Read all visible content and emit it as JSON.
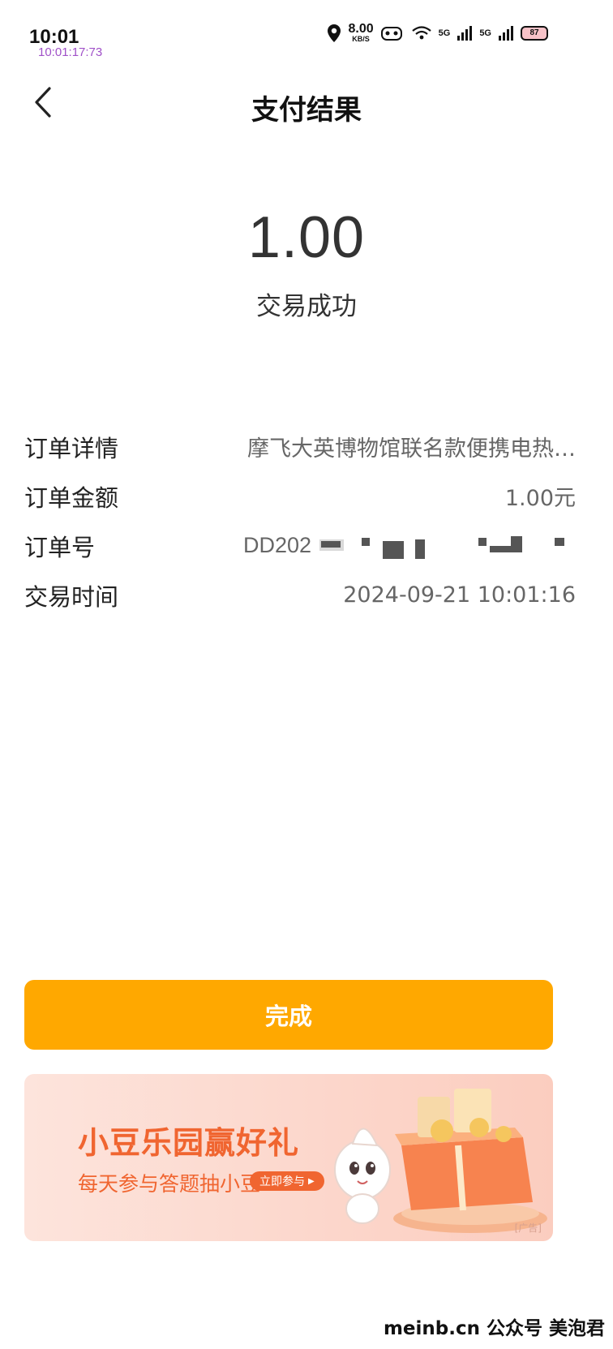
{
  "status_bar": {
    "time": "10:01",
    "sub_time": "10:01:17:73",
    "net_speed": "8.00",
    "net_unit": "KB/S",
    "signal_1": "5G",
    "signal_2": "5G",
    "battery": "87"
  },
  "header": {
    "title": "支付结果"
  },
  "payment": {
    "amount": "1.00",
    "status": "交易成功"
  },
  "details": {
    "rows": [
      {
        "label": "订单详情",
        "value": "摩飞大英博物馆联名款便携电热…"
      },
      {
        "label": "订单金额",
        "value": "1.00元"
      },
      {
        "label": "订单号",
        "value": "DD202"
      },
      {
        "label": "交易时间",
        "value": "2024-09-21 10:01:16"
      }
    ]
  },
  "actions": {
    "done_label": "完成"
  },
  "ad": {
    "title": "小豆乐园赢好礼",
    "subtitle": "每天参与答题抽小豆",
    "cta": "立即参与",
    "tag": "[广告]"
  },
  "watermark": {
    "text": "meinb.cn  公众号 美泡君"
  },
  "colors": {
    "accent": "#ffa800",
    "ad_text": "#f06530",
    "ad_bg": "#fcd7cc",
    "subtime": "#a050c8"
  }
}
